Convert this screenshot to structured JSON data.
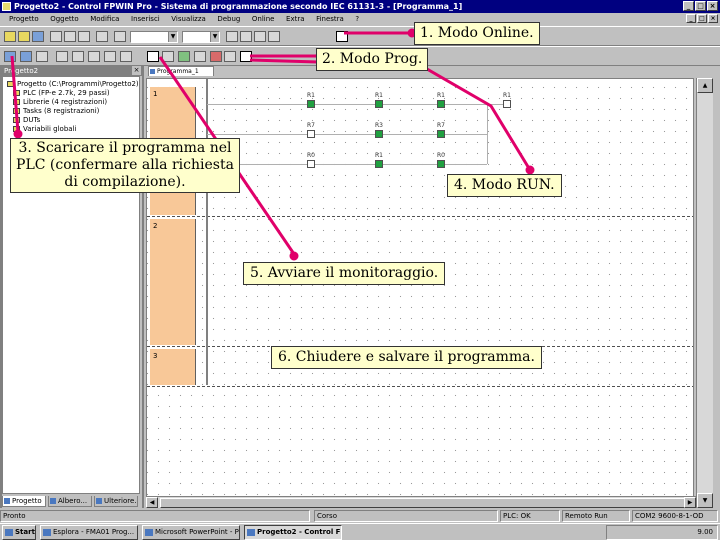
{
  "window": {
    "title": "Progetto2 - Control FPWIN Pro - Sistema di programmazione secondo IEC 61131-3 - [Programma_1]",
    "buttons": [
      "_",
      "□",
      "×"
    ]
  },
  "menu": {
    "items": [
      "Progetto",
      "Oggetto",
      "Modifica",
      "Inserisci",
      "Visualizza",
      "Debug",
      "Online",
      "Extra",
      "Finestra",
      "?"
    ]
  },
  "navigator": {
    "title": "Progetto2",
    "tree": [
      "Progetto (C:\\Programmi\\Progetto2)",
      "PLC (FP-e 2.7k, 29 passi)",
      "Librerie (4 registrazioni)",
      "Tasks (8 registrazioni)",
      "DUTs",
      "Variabili globali"
    ],
    "tabs": [
      "Progetto",
      "Albero...",
      "Ulteriore..."
    ]
  },
  "editor": {
    "tab": "Programma_1",
    "rows": [
      "1",
      "2",
      "3"
    ],
    "contacts_row1": [
      "R1",
      "R1",
      "R1",
      "R1"
    ],
    "contacts_row2": [
      "R7",
      "R3",
      "R7"
    ],
    "contacts_row3": [
      "R0",
      "R1",
      "R0"
    ]
  },
  "status": {
    "left": "Pronto",
    "mode": "Corso",
    "plc": "PLC: OK",
    "run": "Remoto Run",
    "addr": "COM2 9600-8-1-OD"
  },
  "taskbar": {
    "start": "Start",
    "tasks": [
      "Esplora - FMA01 Prog...",
      "Microsoft PowerPoint - Pre...",
      "Progetto2 - Control FP..."
    ],
    "clock": "9.00"
  },
  "callouts": {
    "online": "1. Modo Online.",
    "prog": "2. Modo Prog.",
    "download": "3. Scaricare il programma nel PLC (confermare alla richiesta di compilazione).",
    "run": "4. Modo RUN.",
    "monitor": "5. Avviare il monitoraggio.",
    "close": "6. Chiudere e salvare il programma."
  },
  "colors": {
    "callout_bg": "#ffffcc",
    "arrow": "#e0006a",
    "row_header": "#f8c898",
    "contact_on": "#20a040"
  }
}
